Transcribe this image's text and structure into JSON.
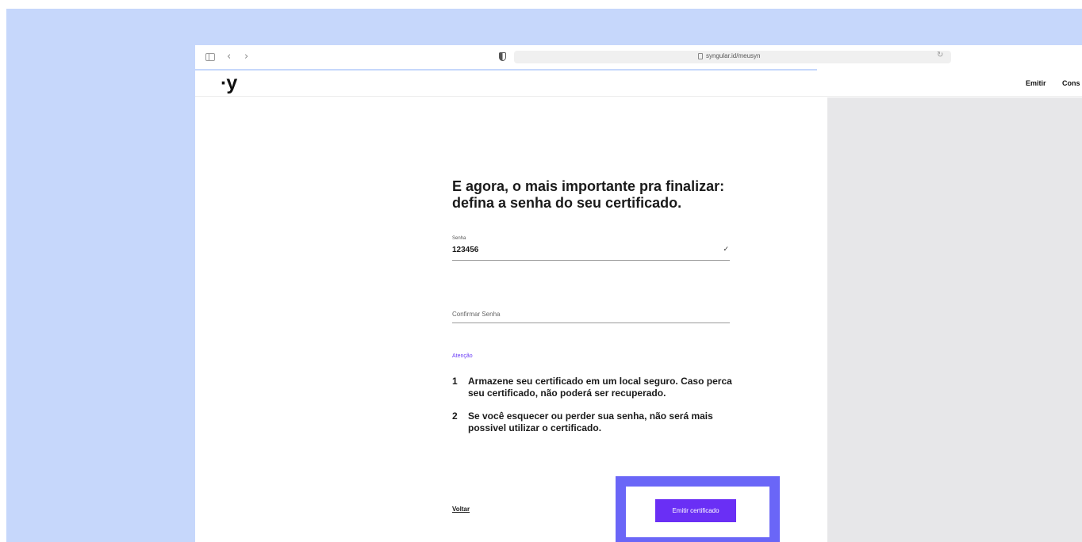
{
  "browser": {
    "url": "syngular.id/meusyn",
    "back_glyph": "‹",
    "forward_glyph": "›",
    "reload_glyph": "↻"
  },
  "header": {
    "logo": "·y",
    "nav": {
      "emitir": "Emitir",
      "cons": "Cons"
    }
  },
  "form": {
    "heading_line1": "E agora, o mais importante pra finalizar:",
    "heading_line2": "defina a senha do seu certificado.",
    "senha": {
      "label": "Senha",
      "value": "123456",
      "status_glyph": "✓"
    },
    "confirm": {
      "placeholder": "Confirmar Senha"
    },
    "attention_label": "Atenção",
    "notes": [
      {
        "number": "1",
        "text": "Armazene seu certificado em um local seguro.  Caso perca seu certificado, não poderá ser recuperado."
      },
      {
        "number": "2",
        "text": "Se você esquecer ou perder sua senha, não será mais possivel utilizar o certificado."
      }
    ],
    "back_label": "Voltar",
    "submit_label": "Emitir certificado"
  },
  "colors": {
    "accent": "#6a2ff5",
    "attention": "#6a3cf6",
    "highlight": "#6a66f7",
    "frame_bg": "#c6d7fb",
    "right_panel": "#e7e7e9"
  }
}
